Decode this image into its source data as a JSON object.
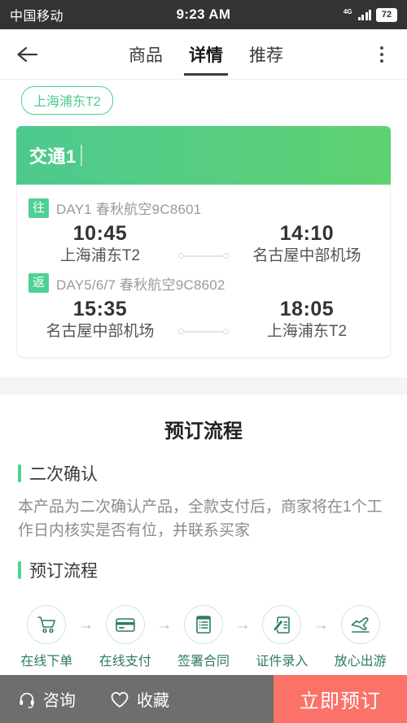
{
  "statusbar": {
    "carrier": "中国移动",
    "time": "9:23 AM",
    "network": "4G",
    "battery": "72"
  },
  "navbar": {
    "back_icon": "arrow-left-icon",
    "more_icon": "more-vertical-icon",
    "tabs": [
      {
        "label": "商品",
        "active": false
      },
      {
        "label": "详情",
        "active": true
      },
      {
        "label": "推荐",
        "active": false
      }
    ]
  },
  "pill": {
    "label": "上海浦东T2"
  },
  "traffic": {
    "header_title": "交通1",
    "flights": [
      {
        "direction": "往",
        "title": "DAY1 春秋航空9C8601",
        "depart_time": "10:45",
        "depart_place": "上海浦东T2",
        "arrive_time": "14:10",
        "arrive_place": "名古屋中部机场"
      },
      {
        "direction": "返",
        "title": "DAY5/6/7 春秋航空9C8602",
        "depart_time": "15:35",
        "depart_place": "名古屋中部机场",
        "arrive_time": "18:05",
        "arrive_place": "上海浦东T2"
      }
    ]
  },
  "booking": {
    "title": "预订流程",
    "confirm_section": {
      "heading": "二次确认",
      "body": "本产品为二次确认产品，全款支付后，商家将在1个工作日内核实是否有位，并联系买家"
    },
    "flow_section": {
      "heading": "预订流程",
      "arrow": "→",
      "steps": [
        {
          "icon": "shopping-cart-icon",
          "label": "在线下单"
        },
        {
          "icon": "credit-card-icon",
          "label": "在线支付"
        },
        {
          "icon": "contract-document-icon",
          "label": "签署合同"
        },
        {
          "icon": "id-document-pen-icon",
          "label": "证件录入"
        },
        {
          "icon": "airplane-takeoff-icon",
          "label": "放心出游"
        }
      ]
    }
  },
  "bottombar": {
    "consult_label": "咨询",
    "consult_icon": "headset-icon",
    "favorite_label": "收藏",
    "favorite_icon": "heart-icon",
    "cta_label": "立即预订"
  },
  "colors": {
    "brand_green": "#4fd094",
    "gradient_end": "#5ed16f",
    "cta_red": "#fa7268",
    "bottom_gray": "#6e6e6e",
    "icon_green": "#2f7d5c"
  }
}
